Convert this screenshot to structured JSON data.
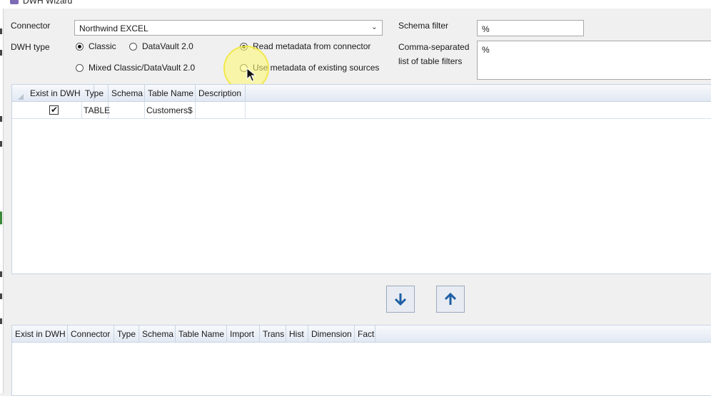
{
  "window": {
    "title": "DWH Wizard"
  },
  "connector": {
    "label": "Connector",
    "value": "Northwind EXCEL"
  },
  "dwh_type": {
    "label": "DWH type",
    "options": [
      "Classic",
      "DataVault 2.0",
      "Mixed Classic/DataVault 2.0"
    ],
    "selected": "Classic"
  },
  "metadata_source": {
    "options": [
      "Read metadata from connector",
      "Use metadata of existing sources"
    ],
    "selected": "Read metadata from connector"
  },
  "schema_filter": {
    "label": "Schema filter",
    "value": "%"
  },
  "table_filters": {
    "label_line1": "Comma-separated",
    "label_line2": "list of table filters",
    "value": "%"
  },
  "source_grid": {
    "columns": [
      "Exist in DWH",
      "Type",
      "Schema",
      "Table Name",
      "Description"
    ],
    "rows": [
      {
        "exist_in_dwh": true,
        "type": "TABLE",
        "schema": "",
        "table_name": "Customers$",
        "description": ""
      }
    ]
  },
  "move_buttons": {
    "down_icon": "arrow-down-icon",
    "up_icon": "arrow-up-icon"
  },
  "target_grid": {
    "columns": [
      "Exist in DWH",
      "Connector",
      "Type",
      "Schema",
      "Table Name",
      "Import",
      "Trans",
      "Hist",
      "Dimension",
      "Fact"
    ],
    "rows": []
  },
  "colors": {
    "accent_arrow": "#1f5fa6",
    "grid_border": "#c7d3e3",
    "highlight": "#fffa6e"
  }
}
